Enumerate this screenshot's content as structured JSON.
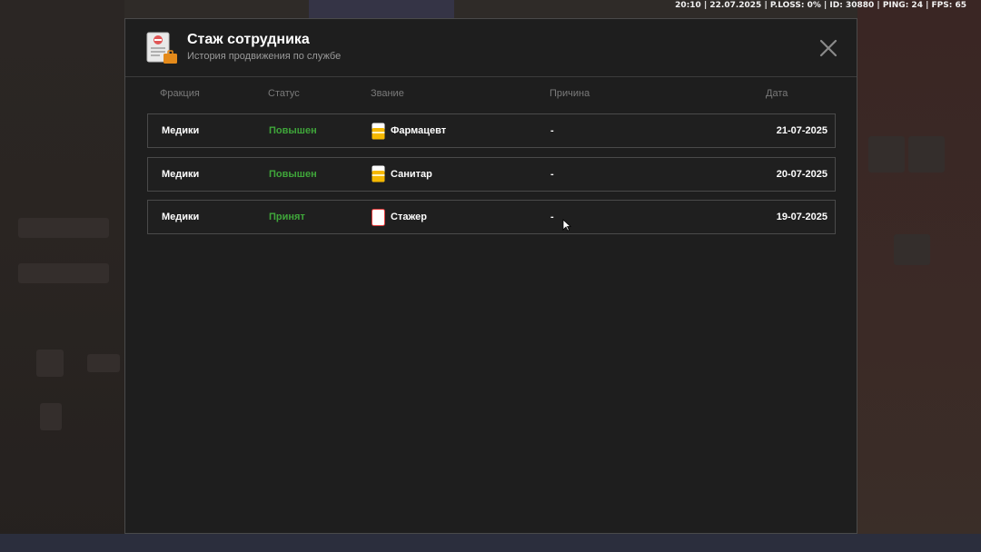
{
  "hud": {
    "text": "20:10 | 22.07.2025 | P.LOSS: 0% | ID: 30880 | PING: 24 | FPS: 65"
  },
  "modal": {
    "title": "Стаж сотрудника",
    "subtitle": "История продвижения по службе",
    "icon": "document-briefcase-icon",
    "close_icon": "close-icon"
  },
  "columns": {
    "faction": "Фракция",
    "status": "Статус",
    "rank": "Звание",
    "reason": "Причина",
    "date": "Дата"
  },
  "rows": [
    {
      "faction": "Медики",
      "status": "Повышен",
      "rank": "Фармацевт",
      "rank_icon": "yellow-rank-icon",
      "reason": "-",
      "date": "21-07-2025"
    },
    {
      "faction": "Медики",
      "status": "Повышен",
      "rank": "Санитар",
      "rank_icon": "yellow-rank-icon",
      "reason": "-",
      "date": "20-07-2025"
    },
    {
      "faction": "Медики",
      "status": "Принят",
      "rank": "Стажер",
      "rank_icon": "white-rank-icon",
      "reason": "-",
      "date": "19-07-2025"
    }
  ],
  "colors": {
    "status_green": "#3fa63a",
    "modal_bg": "#1e1e1e",
    "rank_yellow": "#f5b800"
  }
}
